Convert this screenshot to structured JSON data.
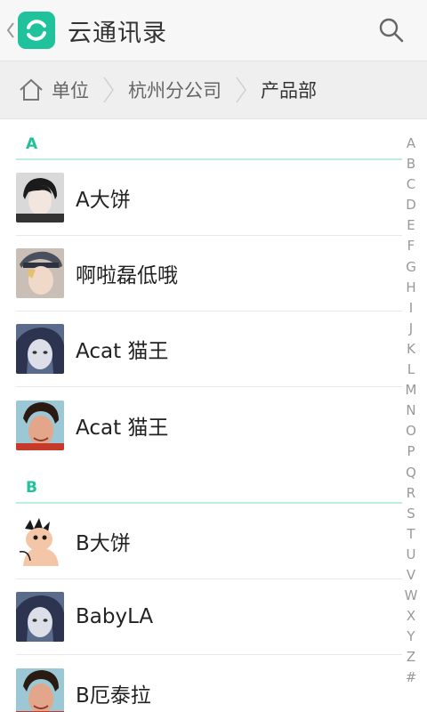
{
  "header": {
    "back_icon": "chevron-left-icon",
    "logo_icon": "cloud-contacts-logo-icon",
    "title": "云通讯录",
    "search_icon": "search-icon",
    "accent": "#1fc29a"
  },
  "breadcrumb": {
    "home_icon": "home-icon",
    "items": [
      "单位",
      "杭州分公司",
      "产品部"
    ]
  },
  "sections": [
    {
      "label": "A",
      "contacts": [
        {
          "name": "A大饼"
        },
        {
          "name": "啊啦磊低哦"
        },
        {
          "name": "Acat 猫王"
        },
        {
          "name": "Acat 猫王"
        }
      ]
    },
    {
      "label": "B",
      "contacts": [
        {
          "name": "B大饼"
        },
        {
          "name": "BabyLA"
        },
        {
          "name": "B厄泰拉"
        }
      ]
    }
  ],
  "index_bar": [
    "A",
    "B",
    "C",
    "D",
    "E",
    "F",
    "G",
    "H",
    "I",
    "J",
    "K",
    "L",
    "M",
    "N",
    "O",
    "P",
    "Q",
    "R",
    "S",
    "T",
    "U",
    "V",
    "W",
    "X",
    "Y",
    "Z",
    "#"
  ]
}
